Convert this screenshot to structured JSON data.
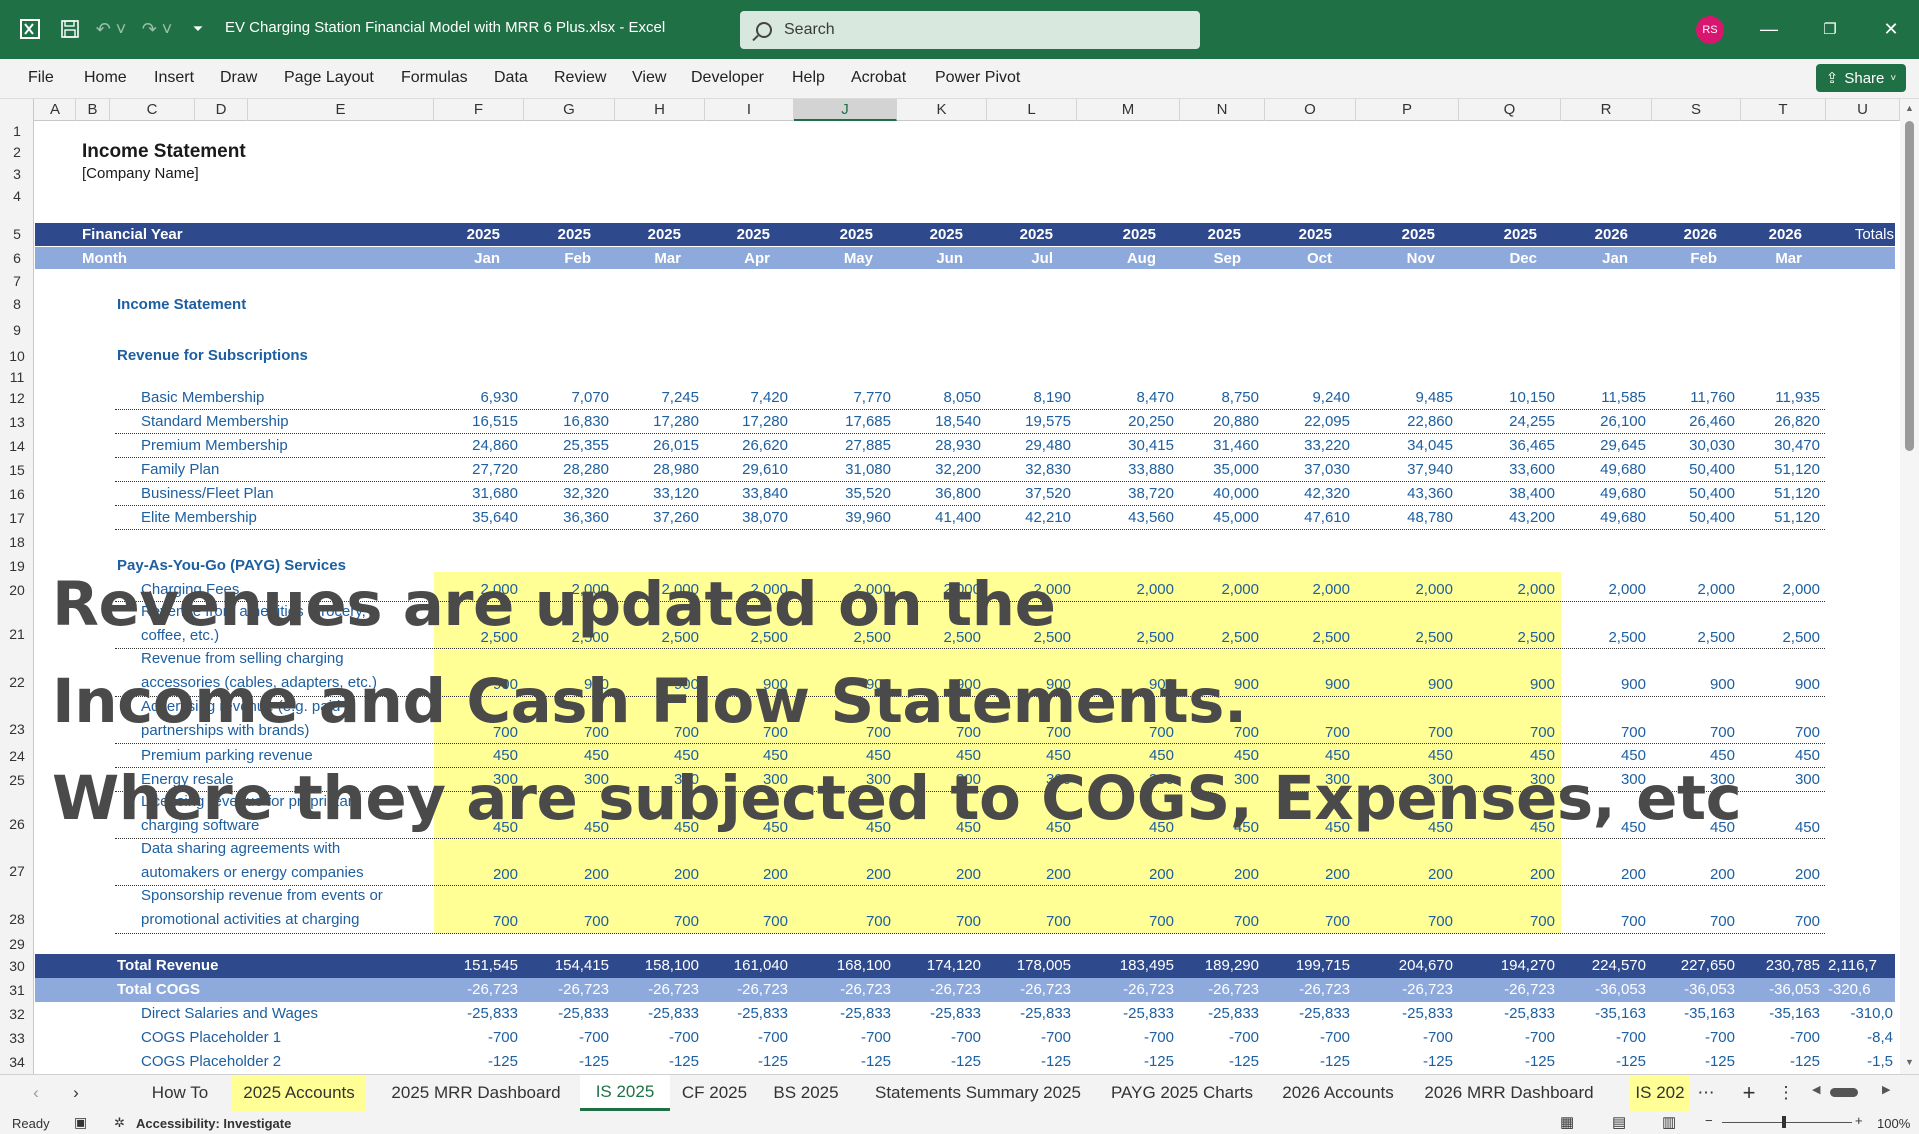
{
  "app": {
    "title": "EV Charging Station Financial Model with MRR 6 Plus.xlsx  -  Excel",
    "search_placeholder": "Search",
    "avatar_initials": "RS",
    "share_label": "Share",
    "accent_color": "#1f7145"
  },
  "menu": [
    "File",
    "Home",
    "Insert",
    "Draw",
    "Page Layout",
    "Formulas",
    "Data",
    "Review",
    "View",
    "Developer",
    "Help",
    "Acrobat",
    "Power Pivot"
  ],
  "columns": [
    "A",
    "B",
    "C",
    "D",
    "E",
    "F",
    "G",
    "H",
    "I",
    "J",
    "K",
    "L",
    "M",
    "N",
    "O",
    "P",
    "Q",
    "R",
    "S",
    "T",
    "U"
  ],
  "selected_column": "J",
  "rows": [
    "1",
    "2",
    "3",
    "4",
    "5",
    "6",
    "7",
    "8",
    "9",
    "10",
    "11",
    "12",
    "13",
    "14",
    "15",
    "16",
    "17",
    "18",
    "19",
    "20",
    "21",
    "22",
    "23",
    "24",
    "25",
    "26",
    "27",
    "28",
    "29",
    "30",
    "31",
    "32",
    "33",
    "34"
  ],
  "sheet": {
    "title": "Income Statement",
    "company": "[Company Name]",
    "financial_year_label": "Financial Year",
    "month_label": "Month",
    "totals_label": "Totals",
    "years": [
      "2025",
      "2025",
      "2025",
      "2025",
      "2025",
      "2025",
      "2025",
      "2025",
      "2025",
      "2025",
      "2025",
      "2025",
      "2026",
      "2026",
      "2026"
    ],
    "months": [
      "Jan",
      "Feb",
      "Mar",
      "Apr",
      "May",
      "Jun",
      "Jul",
      "Aug",
      "Sep",
      "Oct",
      "Nov",
      "Dec",
      "Jan",
      "Feb",
      "Mar"
    ],
    "section_income": "Income Statement",
    "section_subscriptions": "Revenue  for Subscriptions",
    "section_payg": "Pay-As-You-Go (PAYG) Services",
    "subscriptions": [
      {
        "label": "Basic Membership",
        "values": [
          "6,930",
          "7,070",
          "7,245",
          "7,420",
          "7,770",
          "8,050",
          "8,190",
          "8,470",
          "8,750",
          "9,240",
          "9,485",
          "10,150",
          "11,585",
          "11,760",
          "11,935"
        ]
      },
      {
        "label": "Standard Membership",
        "values": [
          "16,515",
          "16,830",
          "17,280",
          "17,280",
          "17,685",
          "18,540",
          "19,575",
          "20,250",
          "20,880",
          "22,095",
          "22,860",
          "24,255",
          "26,100",
          "26,460",
          "26,820"
        ]
      },
      {
        "label": "Premium Membership",
        "values": [
          "24,860",
          "25,355",
          "26,015",
          "26,620",
          "27,885",
          "28,930",
          "29,480",
          "30,415",
          "31,460",
          "33,220",
          "34,045",
          "36,465",
          "29,645",
          "30,030",
          "30,470"
        ]
      },
      {
        "label": "Family Plan",
        "values": [
          "27,720",
          "28,280",
          "28,980",
          "29,610",
          "31,080",
          "32,200",
          "32,830",
          "33,880",
          "35,000",
          "37,030",
          "37,940",
          "33,600",
          "49,680",
          "50,400",
          "51,120"
        ]
      },
      {
        "label": "Business/Fleet Plan",
        "values": [
          "31,680",
          "32,320",
          "33,120",
          "33,840",
          "35,520",
          "36,800",
          "37,520",
          "38,720",
          "40,000",
          "42,320",
          "43,360",
          "38,400",
          "49,680",
          "50,400",
          "51,120"
        ]
      },
      {
        "label": "Elite Membership",
        "values": [
          "35,640",
          "36,360",
          "37,260",
          "38,070",
          "39,960",
          "41,400",
          "42,210",
          "43,560",
          "45,000",
          "47,610",
          "48,780",
          "43,200",
          "49,680",
          "50,400",
          "51,120"
        ]
      }
    ],
    "payg": [
      {
        "label1": "Charging Fees",
        "label2": "",
        "values": [
          "2,000",
          "2,000",
          "2,000",
          "2,000",
          "2,000",
          "2,000",
          "2,000",
          "2,000",
          "2,000",
          "2,000",
          "2,000",
          "2,000",
          "2,000",
          "2,000",
          "2,000"
        ]
      },
      {
        "label1": "Revenue from amenities (grocery,",
        "label2": "coffee, etc.)",
        "values": [
          "2,500",
          "2,500",
          "2,500",
          "2,500",
          "2,500",
          "2,500",
          "2,500",
          "2,500",
          "2,500",
          "2,500",
          "2,500",
          "2,500",
          "2,500",
          "2,500",
          "2,500"
        ]
      },
      {
        "label1": "Revenue from selling charging",
        "label2": "accessories (cables, adapters, etc.)",
        "values": [
          "900",
          "900",
          "900",
          "900",
          "900",
          "900",
          "900",
          "900",
          "900",
          "900",
          "900",
          "900",
          "900",
          "900",
          "900"
        ]
      },
      {
        "label1": "Advertising revenue (e.g. paid",
        "label2": "partnerships with brands)",
        "values": [
          "700",
          "700",
          "700",
          "700",
          "700",
          "700",
          "700",
          "700",
          "700",
          "700",
          "700",
          "700",
          "700",
          "700",
          "700"
        ]
      },
      {
        "label1": "Premium parking revenue",
        "label2": "",
        "values": [
          "450",
          "450",
          "450",
          "450",
          "450",
          "450",
          "450",
          "450",
          "450",
          "450",
          "450",
          "450",
          "450",
          "450",
          "450"
        ]
      },
      {
        "label1": "Energy resale",
        "label2": "",
        "values": [
          "300",
          "300",
          "300",
          "300",
          "300",
          "300",
          "300",
          "300",
          "300",
          "300",
          "300",
          "300",
          "300",
          "300",
          "300"
        ]
      },
      {
        "label1": "Licensing revenue for proprietary",
        "label2": "charging software",
        "values": [
          "450",
          "450",
          "450",
          "450",
          "450",
          "450",
          "450",
          "450",
          "450",
          "450",
          "450",
          "450",
          "450",
          "450",
          "450"
        ]
      },
      {
        "label1": "Data sharing agreements with",
        "label2": "automakers or energy companies",
        "values": [
          "200",
          "200",
          "200",
          "200",
          "200",
          "200",
          "200",
          "200",
          "200",
          "200",
          "200",
          "200",
          "200",
          "200",
          "200"
        ]
      },
      {
        "label1": "Sponsorship revenue from events or",
        "label2": "promotional activities at charging",
        "values": [
          "700",
          "700",
          "700",
          "700",
          "700",
          "700",
          "700",
          "700",
          "700",
          "700",
          "700",
          "700",
          "700",
          "700",
          "700"
        ]
      }
    ],
    "total_revenue": {
      "label": "Total Revenue",
      "values": [
        "151,545",
        "154,415",
        "158,100",
        "161,040",
        "168,100",
        "174,120",
        "178,005",
        "183,495",
        "189,290",
        "199,715",
        "204,670",
        "194,270",
        "224,570",
        "227,650",
        "230,785"
      ],
      "total": "2,116,7"
    },
    "total_cogs": {
      "label": "Total COGS",
      "values": [
        "-26,723",
        "-26,723",
        "-26,723",
        "-26,723",
        "-26,723",
        "-26,723",
        "-26,723",
        "-26,723",
        "-26,723",
        "-26,723",
        "-26,723",
        "-26,723",
        "-36,053",
        "-36,053",
        "-36,053"
      ],
      "total": "-320,6"
    },
    "cogs_lines": [
      {
        "label": "Direct Salaries and Wages",
        "values": [
          "-25,833",
          "-25,833",
          "-25,833",
          "-25,833",
          "-25,833",
          "-25,833",
          "-25,833",
          "-25,833",
          "-25,833",
          "-25,833",
          "-25,833",
          "-25,833",
          "-35,163",
          "-35,163",
          "-35,163"
        ],
        "total": "-310,0"
      },
      {
        "label": "COGS Placeholder 1",
        "values": [
          "-700",
          "-700",
          "-700",
          "-700",
          "-700",
          "-700",
          "-700",
          "-700",
          "-700",
          "-700",
          "-700",
          "-700",
          "-700",
          "-700",
          "-700"
        ],
        "total": "-8,4"
      },
      {
        "label": "COGS Placeholder 2",
        "values": [
          "-125",
          "-125",
          "-125",
          "-125",
          "-125",
          "-125",
          "-125",
          "-125",
          "-125",
          "-125",
          "-125",
          "-125",
          "-125",
          "-125",
          "-125"
        ],
        "total": "-1,5"
      }
    ]
  },
  "overlay": {
    "line1": "Revenues are updated on the",
    "line2": "Income and Cash Flow Statements.",
    "line3": "Where they are subjected to COGS, Expenses, etc"
  },
  "tabs": [
    "How To",
    "2025 Accounts",
    "2025 MRR Dashboard",
    "IS 2025",
    "CF 2025",
    "BS 2025",
    "Statements Summary 2025",
    "PAYG 2025 Charts",
    "2026 Accounts",
    "2026 MRR Dashboard",
    "IS 202"
  ],
  "active_tab": "IS 2025",
  "status": {
    "ready": "Ready",
    "accessibility": "Accessibility: Investigate",
    "zoom": "100%"
  }
}
